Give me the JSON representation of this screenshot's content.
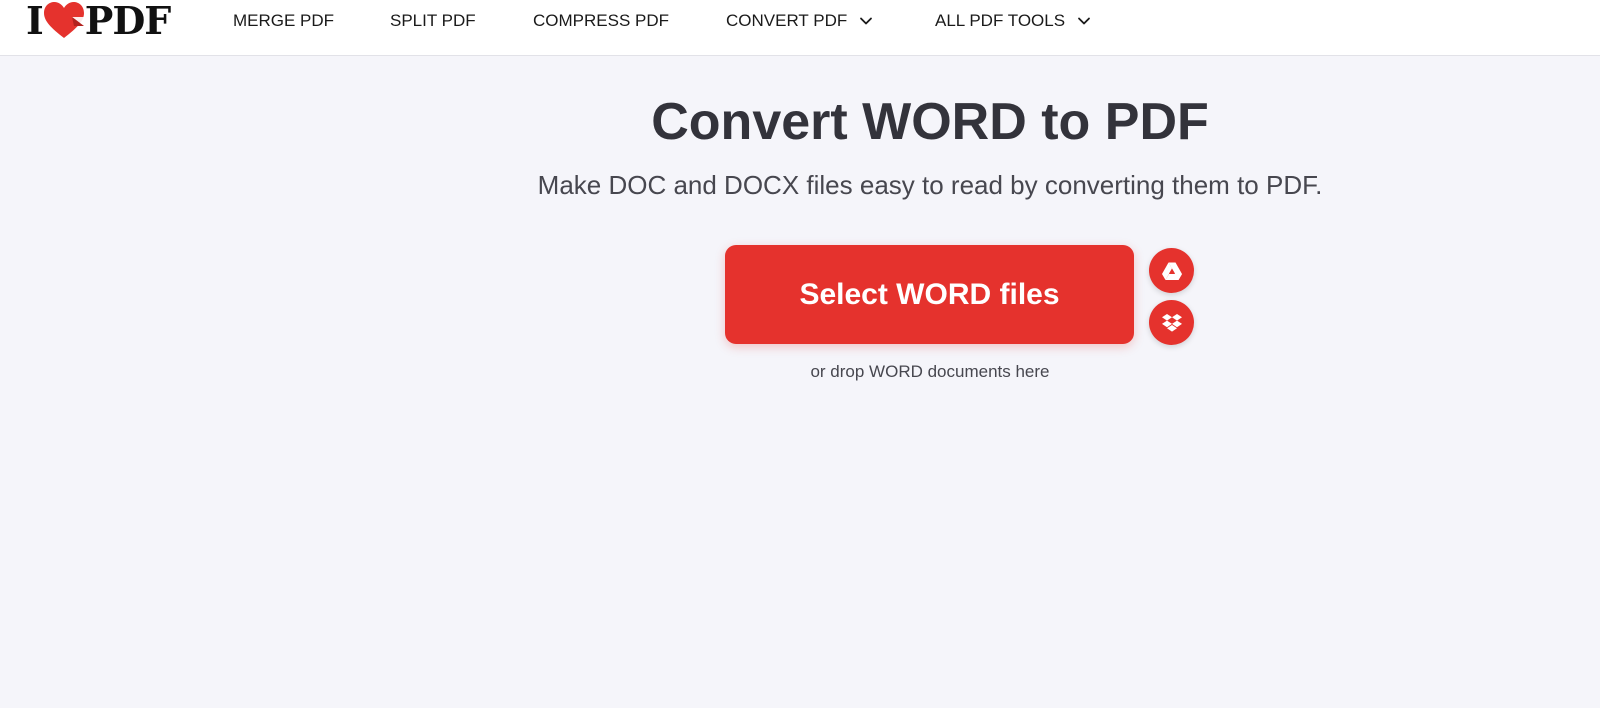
{
  "brand": {
    "logo_left": "I",
    "logo_right": "PDF",
    "accent_color": "#e5322d"
  },
  "nav": {
    "items": [
      {
        "label": "MERGE PDF",
        "has_dropdown": false
      },
      {
        "label": "SPLIT PDF",
        "has_dropdown": false
      },
      {
        "label": "COMPRESS PDF",
        "has_dropdown": false
      },
      {
        "label": "CONVERT PDF",
        "has_dropdown": true
      },
      {
        "label": "ALL PDF TOOLS",
        "has_dropdown": true
      }
    ]
  },
  "main": {
    "title": "Convert WORD to PDF",
    "subtitle": "Make DOC and DOCX files easy to read by converting them to PDF.",
    "select_button_label": "Select WORD files",
    "drop_hint": "or drop WORD documents here",
    "cloud_sources": [
      {
        "icon": "google-drive-icon"
      },
      {
        "icon": "dropbox-icon"
      }
    ]
  }
}
